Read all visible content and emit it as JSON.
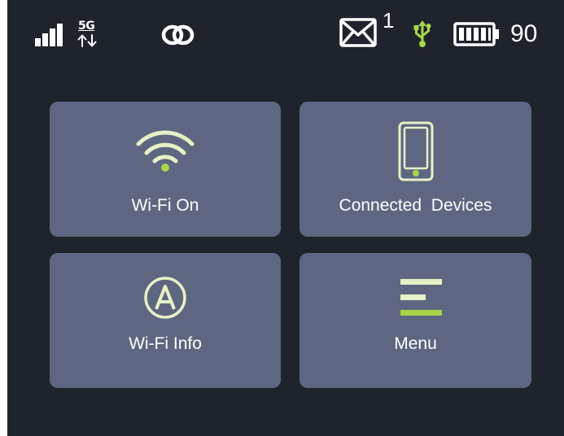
{
  "status_bar": {
    "signal_icon": "signal-bars-icon",
    "network_type": "5G",
    "network_activity_icon": "up-down-arrows-icon",
    "link_icon": "chain-link-icon",
    "messages_icon": "envelope-icon",
    "message_count": "1",
    "usb_icon": "usb-icon",
    "battery_icon": "battery-icon",
    "battery_level": "90"
  },
  "tiles": [
    {
      "label": "Wi-Fi On",
      "icon": "wifi-icon"
    },
    {
      "label": "Connected  Devices",
      "icon": "phone-icon"
    },
    {
      "label": "Wi-Fi Info",
      "icon": "circled-a-icon"
    },
    {
      "label": "Menu",
      "icon": "menu-icon"
    }
  ],
  "colors": {
    "background": "#1f232b",
    "tile": "#5d6781",
    "accent_green": "#a6d64a",
    "icon_cream": "#e8f0c8",
    "text": "#ffffff"
  }
}
